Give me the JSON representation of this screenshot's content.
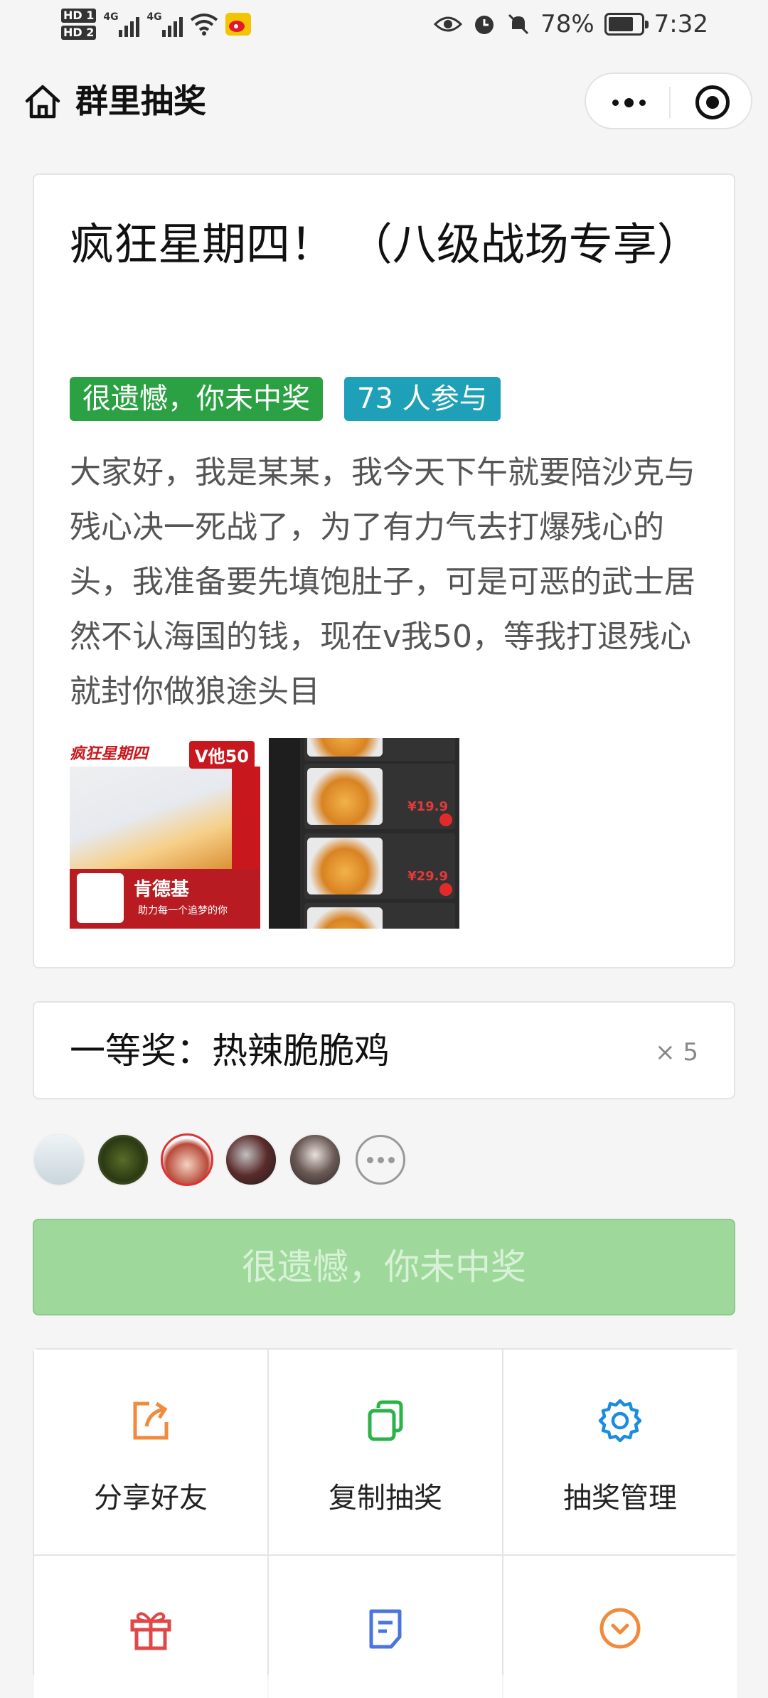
{
  "status_bar": {
    "hd1": "HD 1",
    "hd2": "HD 2",
    "net1": "4G",
    "net2": "4G",
    "battery": "78%",
    "battery_level": 0.78,
    "time": "7:32"
  },
  "nav": {
    "title": "群里抽奖"
  },
  "post": {
    "title": "疯狂星期四！ （八级战场专享）",
    "tag_status": "很遗憾，你未中奖",
    "tag_participants": "73 人参与",
    "description": "大家好，我是某某，我今天下午就要陪沙克与残心决一死战了，为了有力气去打爆残心的头，我准备要先填饱肚子，可是可恶的武士居然不认海国的钱，现在v我50，等我打退残心就封你做狼途头目",
    "image1_top_text": "疯狂星期四",
    "image1_price": "V他50",
    "image1_brand": "肯德基",
    "image1_slogan": "助力每一个追梦的你",
    "image2_price1": "¥19.9",
    "image2_price2": "¥29.9"
  },
  "prize": {
    "name": "一等奖：热辣脆脆鸡",
    "count": "× 5"
  },
  "result_button": "很遗憾，你未中奖",
  "actions": [
    {
      "label": "分享好友",
      "icon": "share-icon",
      "color": "#f08a3c"
    },
    {
      "label": "复制抽奖",
      "icon": "copy-icon",
      "color": "#2bb34a"
    },
    {
      "label": "抽奖管理",
      "icon": "gear-icon",
      "color": "#1a8de0"
    },
    {
      "label": "",
      "icon": "gift-icon",
      "color": "#e04848"
    },
    {
      "label": "",
      "icon": "document-icon",
      "color": "#4a74e0"
    },
    {
      "label": "",
      "icon": "chevron-down-circle-icon",
      "color": "#f08a3c"
    }
  ]
}
